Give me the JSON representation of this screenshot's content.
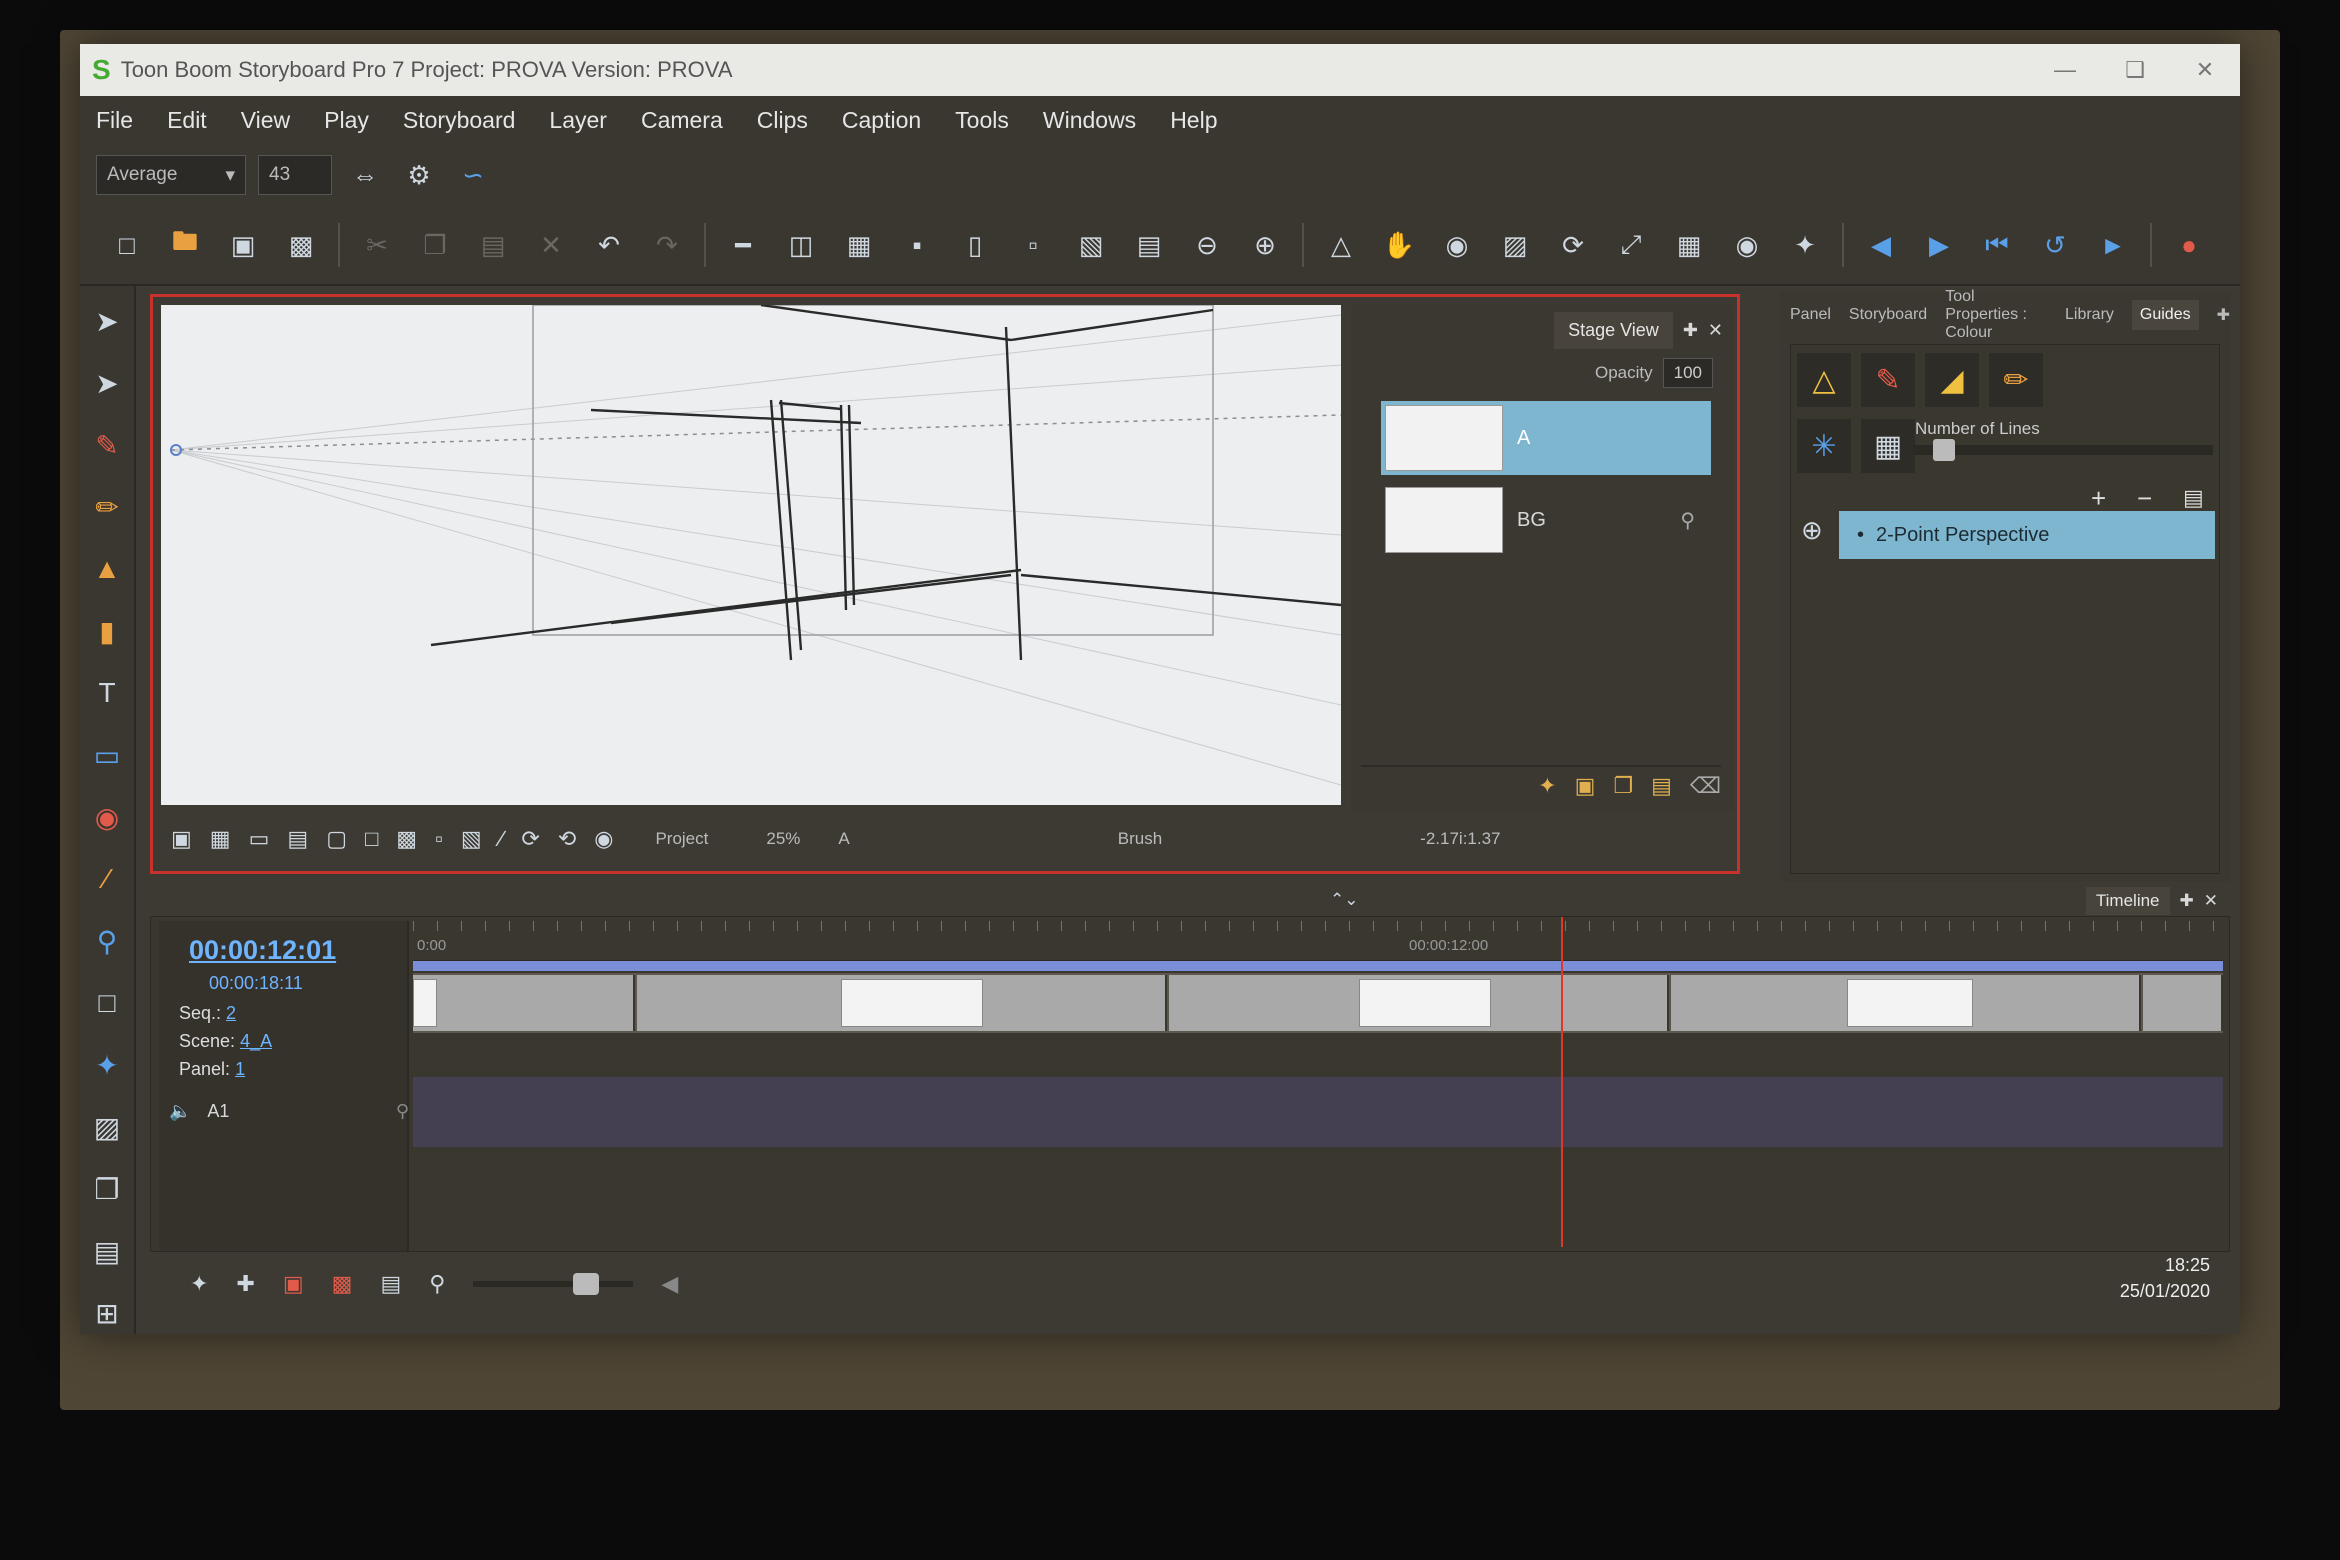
{
  "window": {
    "title": "Toon Boom Storyboard Pro 7 Project: PROVA Version: PROVA",
    "logo": "S"
  },
  "menu": [
    "File",
    "Edit",
    "View",
    "Play",
    "Storyboard",
    "Layer",
    "Camera",
    "Clips",
    "Caption",
    "Tools",
    "Windows",
    "Help"
  ],
  "toolbar": {
    "brush_preset": "Average",
    "brush_size": "43"
  },
  "stage": {
    "tab": "Stage View",
    "opacity_label": "Opacity",
    "opacity_value": "100",
    "layers": [
      {
        "name": "A",
        "selected": true
      },
      {
        "name": "BG",
        "selected": false
      }
    ],
    "status": {
      "project": "Project",
      "zoom": "25%",
      "layer": "A",
      "tool": "Brush",
      "coords": "-2.17i:1.37"
    }
  },
  "right_panel": {
    "tabs": [
      "Panel",
      "Storyboard",
      "Tool Properties : Colour",
      "Library",
      "Guides"
    ],
    "active_tab": "Guides",
    "number_of_lines_label": "Number of Lines",
    "guide_list": [
      "2-Point Perspective"
    ]
  },
  "timeline": {
    "tab": "Timeline",
    "timecode": "00:00:12:01",
    "duration": "00:00:18:11",
    "seq_label": "Seq.:",
    "seq_value": "2",
    "scene_label": "Scene:",
    "scene_value": "4_A",
    "panel_label": "Panel:",
    "panel_value": "1",
    "ruler_start": "0:00",
    "ruler_mark": "00:00:12:00",
    "audio_track": "A1"
  },
  "system": {
    "time": "18:25",
    "date": "25/01/2020"
  },
  "taskbar": [
    "windows-start",
    "search",
    "file-explorer",
    "chrome",
    "creative-cloud",
    "premiere",
    "wattpad",
    "spotify",
    "davinci",
    "storyboard-pro"
  ]
}
